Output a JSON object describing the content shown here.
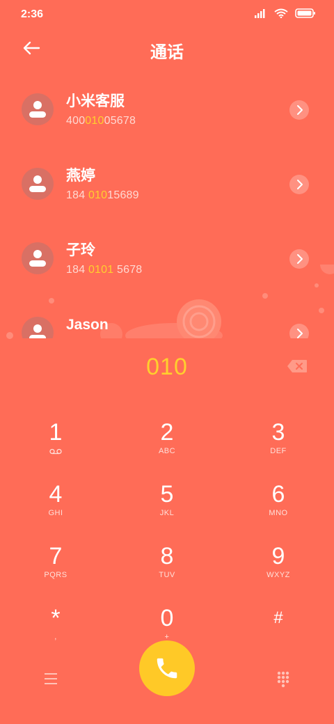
{
  "status": {
    "time": "2:36"
  },
  "header": {
    "title": "通话"
  },
  "contacts": [
    {
      "name": "小米客服",
      "number_pre": "400",
      "number_hl": "010",
      "number_post": "05678"
    },
    {
      "name": "燕婷",
      "number_pre": "184 ",
      "number_hl": "010",
      "number_post": "15689"
    },
    {
      "name": "子玲",
      "number_pre": "184 ",
      "number_hl": "0101",
      "number_post": " 5678"
    },
    {
      "name": "Jason",
      "number_pre": "",
      "number_hl": "",
      "number_post": ""
    }
  ],
  "dialpad": {
    "dialed": "010",
    "keys": [
      {
        "digit": "1",
        "letters": ""
      },
      {
        "digit": "2",
        "letters": "ABC"
      },
      {
        "digit": "3",
        "letters": "DEF"
      },
      {
        "digit": "4",
        "letters": "GHI"
      },
      {
        "digit": "5",
        "letters": "JKL"
      },
      {
        "digit": "6",
        "letters": "MNO"
      },
      {
        "digit": "7",
        "letters": "PQRS"
      },
      {
        "digit": "8",
        "letters": "TUV"
      },
      {
        "digit": "9",
        "letters": "WXYZ"
      },
      {
        "digit": "*",
        "letters": ","
      },
      {
        "digit": "0",
        "letters": "+"
      },
      {
        "digit": "#",
        "letters": ""
      }
    ]
  },
  "colors": {
    "background": "#ff6c57",
    "highlight": "#ffcf2e",
    "call_button": "#ffc927"
  },
  "icons": {
    "back": "arrow-left-icon",
    "chevron": "chevron-right-icon",
    "backspace": "backspace-icon",
    "voicemail": "voicemail-icon",
    "menu": "menu-icon",
    "call": "phone-icon",
    "keypad": "keypad-icon"
  }
}
